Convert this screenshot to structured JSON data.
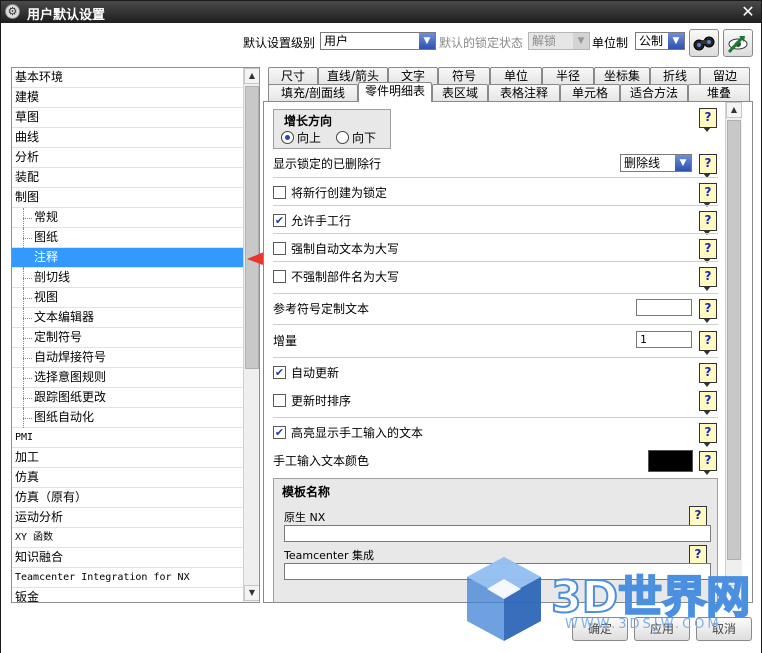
{
  "window": {
    "title": "用户默认设置",
    "close_symbol": "✕",
    "app_icon_symbol": "⚙"
  },
  "toolbar": {
    "level_label": "默认设置级别",
    "level_value": "用户",
    "lock_label": "默认的锁定状态",
    "lock_value": "解锁",
    "unit_label": "单位制",
    "unit_value": "公制"
  },
  "nav": {
    "items": [
      {
        "label": "基本环境",
        "child": false
      },
      {
        "label": "建模",
        "child": false
      },
      {
        "label": "草图",
        "child": false
      },
      {
        "label": "曲线",
        "child": false
      },
      {
        "label": "分析",
        "child": false
      },
      {
        "label": "装配",
        "child": false
      },
      {
        "label": "制图",
        "child": false
      },
      {
        "label": "常规",
        "child": true
      },
      {
        "label": "图纸",
        "child": true
      },
      {
        "label": "注释",
        "child": true,
        "selected": true
      },
      {
        "label": "剖切线",
        "child": true
      },
      {
        "label": "视图",
        "child": true
      },
      {
        "label": "文本编辑器",
        "child": true
      },
      {
        "label": "定制符号",
        "child": true
      },
      {
        "label": "自动焊接符号",
        "child": true
      },
      {
        "label": "选择意图规则",
        "child": true
      },
      {
        "label": "跟踪图纸更改",
        "child": true
      },
      {
        "label": "图纸自动化",
        "child": true
      },
      {
        "label": "PMI",
        "child": false
      },
      {
        "label": "加工",
        "child": false
      },
      {
        "label": "仿真",
        "child": false
      },
      {
        "label": "仿真（原有）",
        "child": false
      },
      {
        "label": "运动分析",
        "child": false
      },
      {
        "label": "XY 函数",
        "child": false
      },
      {
        "label": "知识融合",
        "child": false
      },
      {
        "label": "Teamcenter Integration for NX",
        "child": false
      },
      {
        "label": "钣金",
        "child": false
      }
    ]
  },
  "tabs": {
    "row1": [
      "尺寸",
      "直线/箭头",
      "文字",
      "符号",
      "单位",
      "半径",
      "坐标集",
      "折线",
      "留边"
    ],
    "row2": [
      "填充/剖面线",
      "零件明细表",
      "表区域",
      "表格注释",
      "单元格",
      "适合方法",
      "堆叠"
    ],
    "active": "零件明细表"
  },
  "panel": {
    "growth": {
      "title": "增长方向",
      "up": "向上",
      "down": "向下"
    },
    "show_locked_deleted": {
      "label": "显示锁定的已删除行",
      "value": "删除线"
    },
    "create_new_locked": "将新行创建为锁定",
    "allow_manual_rows": "允许手工行",
    "force_uppercase": "强制自动文本为大写",
    "no_force_part_uppercase": "不强制部件名为大写",
    "ref_symbol_text": "参考符号定制文本",
    "ref_symbol_value": "",
    "increment_label": "增量",
    "increment_value": "1",
    "auto_update": "自动更新",
    "sort_on_update": "更新时排序",
    "highlight_manual": "高亮显示手工输入的文本",
    "manual_text_color": "手工输入文本颜色",
    "template": {
      "title": "模板名称",
      "native": "原生 NX",
      "native_value": "",
      "teamcenter": "Teamcenter 集成",
      "teamcenter_value": ""
    },
    "help_symbol": "?"
  },
  "buttons": {
    "ok": "确定",
    "apply": "应用",
    "cancel": "取消"
  },
  "watermark": {
    "brand": "3D世界网",
    "url": "WWW.3DSJW.COM"
  },
  "colors": {
    "selection": "#3399ff",
    "manual_text_swatch": "#000000",
    "arrow": "#e8352e",
    "checkmark": "#1a3fb8"
  }
}
